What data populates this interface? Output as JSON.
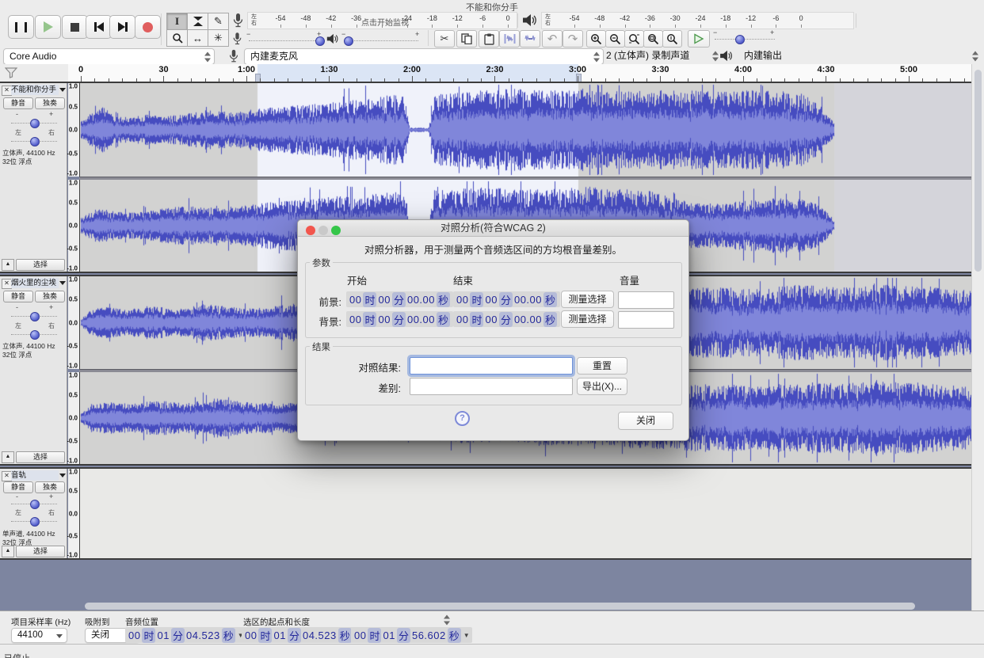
{
  "window": {
    "title": "不能和你分手"
  },
  "toolbar": {
    "monitor_text": "点击开始监视",
    "meter_left": "左",
    "meter_right": "右",
    "meter_ticks": [
      "-54",
      "-48",
      "-42",
      "-36",
      "-30",
      "-24",
      "-18",
      "-12",
      "-6",
      "0"
    ]
  },
  "device": {
    "host": "Core Audio",
    "input": "内建麦克风",
    "channels": "2 (立体声) 录制声道",
    "output": "内建输出"
  },
  "timeline": {
    "major_labels": [
      "0",
      "30",
      "1:00",
      "1:30",
      "2:00",
      "2:30",
      "3:00",
      "3:30",
      "4:00",
      "4:30",
      "5:00"
    ]
  },
  "ruler_values": [
    "1.0",
    "0.5",
    "0.0",
    "-0.5",
    "-1.0"
  ],
  "tracks": [
    {
      "name": "不能和你分手",
      "mute": "静音",
      "solo": "独奏",
      "gain_minus": "-",
      "gain_plus": "+",
      "pan_left": "左",
      "pan_right": "右",
      "info_line1": "立体声, 44100 Hz",
      "info_line2": "32位 浮点",
      "select_label": "选择"
    },
    {
      "name": "烟火里的尘埃",
      "mute": "静音",
      "solo": "独奏",
      "gain_minus": "-",
      "gain_plus": "+",
      "pan_left": "左",
      "pan_right": "右",
      "info_line1": "立体声, 44100 Hz",
      "info_line2": "32位 浮点",
      "select_label": "选择"
    },
    {
      "name": "音轨",
      "mute": "静音",
      "solo": "独奏",
      "gain_minus": "-",
      "gain_plus": "+",
      "pan_left": "左",
      "pan_right": "右",
      "info_line1": "单声道, 44100 Hz",
      "info_line2": "32位 浮点",
      "select_label": "选择"
    }
  ],
  "dialog": {
    "title": "对照分析(符合WCAG 2)",
    "description": "对照分析器，用于测量两个音频选区间的方均根音量差别。",
    "params_label": "参数",
    "col_start": "开始",
    "col_end": "结束",
    "col_volume": "音量",
    "fg_label": "前景:",
    "bg_label": "背景:",
    "measure_btn": "测量选择",
    "results_label": "结果",
    "contrast_label": "对照结果:",
    "diff_label": "差别:",
    "contrast_value": "",
    "diff_value": "",
    "reset_btn": "重置",
    "export_btn": "导出(X)...",
    "close_btn": "关闭",
    "help": "?",
    "time_zero": [
      [
        "00",
        "d"
      ],
      [
        "时",
        "u"
      ],
      [
        "00",
        "d"
      ],
      [
        "分",
        "u"
      ],
      [
        "00.00",
        "d"
      ],
      [
        "秒",
        "u"
      ]
    ]
  },
  "bottom": {
    "rate_label": "项目采样率 (Hz)",
    "rate_value": "44100",
    "snap_label": "吸附到",
    "snap_value": "关闭",
    "audio_pos_label": "音频位置",
    "sel_label": "选区的起点和长度",
    "audio_pos": [
      [
        "00",
        "d"
      ],
      [
        "时",
        "u"
      ],
      [
        "01",
        "d"
      ],
      [
        "分",
        "u"
      ],
      [
        "04.523",
        "d"
      ],
      [
        "秒",
        "u"
      ]
    ],
    "sel_start": [
      [
        "00",
        "d"
      ],
      [
        "时",
        "u"
      ],
      [
        "01",
        "d"
      ],
      [
        "分",
        "u"
      ],
      [
        "04.523",
        "d"
      ],
      [
        "秒",
        "u"
      ]
    ],
    "sel_len": [
      [
        "00",
        "d"
      ],
      [
        "时",
        "u"
      ],
      [
        "01",
        "d"
      ],
      [
        "分",
        "u"
      ],
      [
        "56.602",
        "d"
      ],
      [
        "秒",
        "u"
      ]
    ]
  },
  "status": {
    "text": "已停止."
  },
  "colors": {
    "wave_peak": "#464cc0",
    "wave_rms": "#8086da",
    "selection_bg": "#f0f2fa",
    "track_bg": "#d2d2d1",
    "accent": "#4a55c8"
  }
}
